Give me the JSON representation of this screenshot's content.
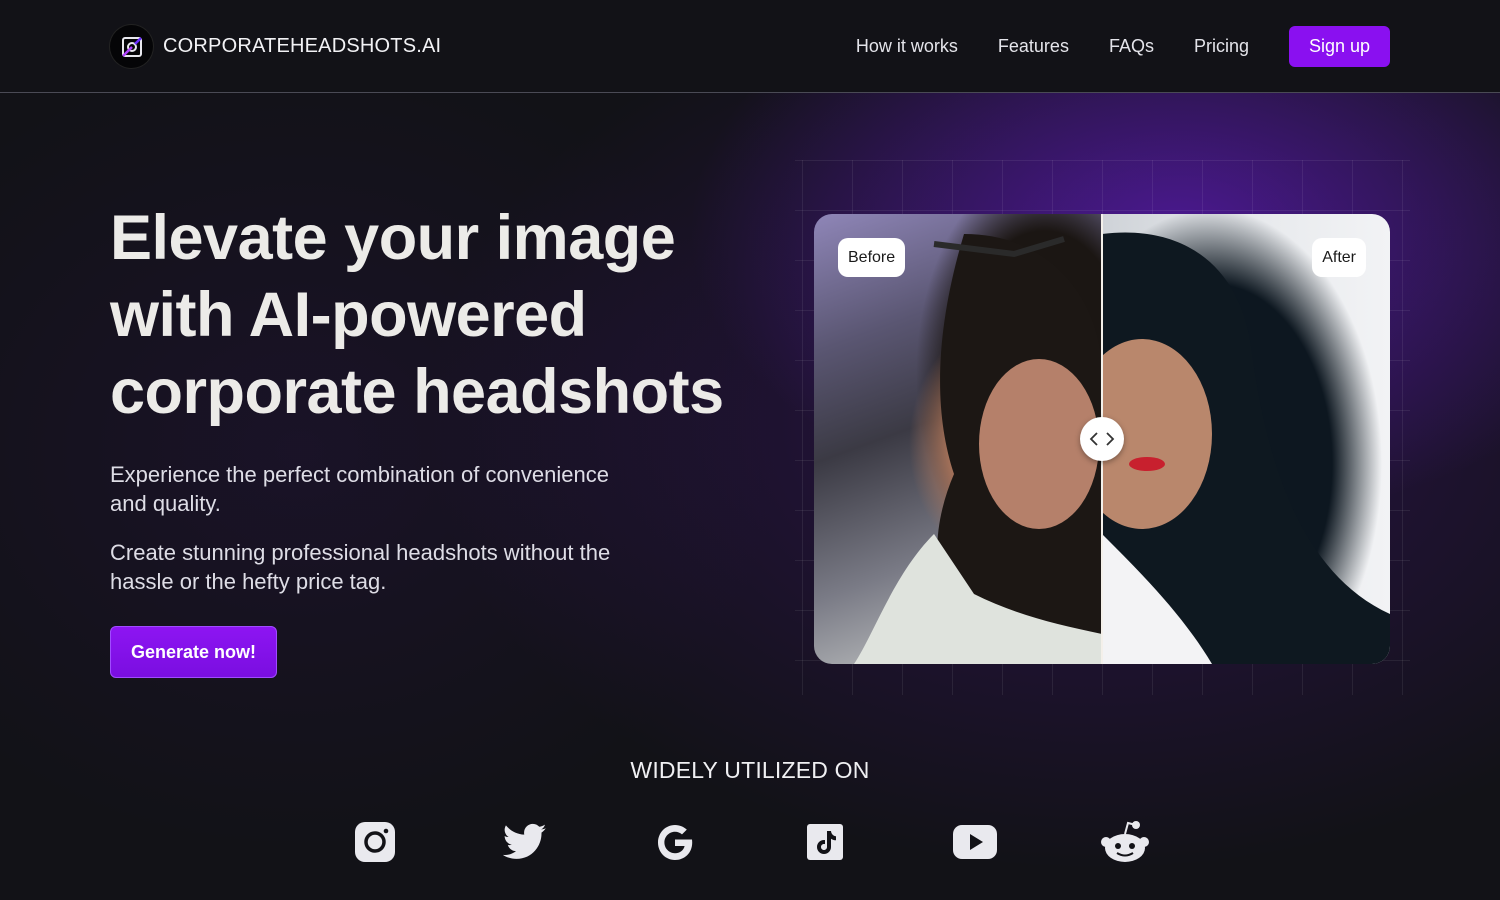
{
  "header": {
    "brand_name": "CORPORATEHEADSHOTS.AI",
    "logo_icon": "camera-aperture-logo",
    "nav": [
      {
        "label": "How it works"
      },
      {
        "label": "Features"
      },
      {
        "label": "FAQs"
      },
      {
        "label": "Pricing"
      }
    ],
    "signup_label": "Sign up"
  },
  "hero": {
    "title": "Elevate your image with AI-powered corporate headshots",
    "subtitle_1": "Experience the perfect combination of convenience and quality.",
    "subtitle_2": "Create stunning professional headshots without the hassle or the hefty price tag.",
    "cta_label": "Generate now!"
  },
  "compare": {
    "before_label": "Before",
    "after_label": "After",
    "handle_icon": "chevrons-left-right-icon",
    "slider_position_fraction": 0.5
  },
  "utilized": {
    "heading": "WIDELY UTILIZED ON",
    "platforms": [
      "instagram-icon",
      "twitter-icon",
      "google-icon",
      "tiktok-icon",
      "youtube-icon",
      "reddit-icon"
    ]
  },
  "colors": {
    "accent": "#8a10f0",
    "background": "#121217",
    "text": "#ececf1"
  }
}
